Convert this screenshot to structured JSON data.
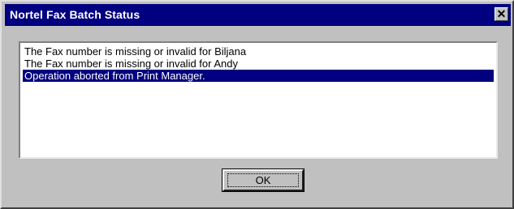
{
  "window": {
    "title": "Nortel Fax Batch Status",
    "close_glyph": "✕"
  },
  "messages": [
    {
      "text": "The Fax number is missing or invalid for Biljana",
      "selected": false
    },
    {
      "text": "The Fax number is missing or invalid for Andy",
      "selected": false
    },
    {
      "text": "Operation aborted from Print Manager.",
      "selected": true
    }
  ],
  "buttons": {
    "ok_label": "OK"
  },
  "colors": {
    "titlebar": "#000080",
    "face": "#c0c0c0",
    "selection": "#000080"
  },
  "icons": {
    "close": "close-icon"
  }
}
